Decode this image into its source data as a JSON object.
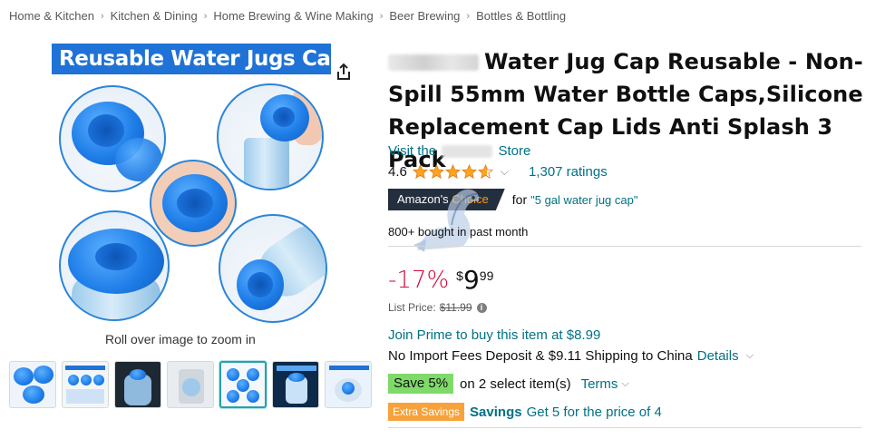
{
  "breadcrumb": [
    "Home & Kitchen",
    "Kitchen & Dining",
    "Home Brewing & Wine Making",
    "Beer Brewing",
    "Bottles & Bottling"
  ],
  "image": {
    "banner": "Reusable Water Jugs Caps",
    "zoom_hint": "Roll over image to zoom in",
    "thumbnail_count": 7,
    "selected_thumbnail": 5
  },
  "product": {
    "title": "Water Jug Cap Reusable - Non-Spill 55mm Water Bottle Caps,Silicone Replacement Cap Lids Anti Splash 3 Pack",
    "store_prefix": "Visit the",
    "store_suffix": "Store"
  },
  "rating": {
    "value": "4.6",
    "stars": 4.6,
    "count_label": "1,307 ratings"
  },
  "choice": {
    "badge_main": "Amazon's",
    "badge_accent": "Choice",
    "for_label": "for",
    "keyword": "\"5 gal water jug cap\""
  },
  "bought": "800+ bought in past month",
  "price": {
    "discount": "-17%",
    "symbol": "$",
    "whole": "9",
    "fraction": "99",
    "list_label": "List Price:",
    "list_value": "$11.99"
  },
  "prime": "Join Prime to buy this item at $8.99",
  "shipping": {
    "text": "No Import Fees Deposit & $9.11 Shipping to China",
    "details": "Details"
  },
  "coupon": {
    "badge": "Save 5%",
    "text": "on 2 select item(s)",
    "terms": "Terms"
  },
  "extra": {
    "badge": "Extra Savings",
    "bold": "Savings",
    "text": "Get 5 for the price of 4"
  },
  "colors": {
    "link": "#007185",
    "deal_red": "#cc0c39",
    "star": "#ffa41c",
    "banner": "#1f72d6"
  }
}
